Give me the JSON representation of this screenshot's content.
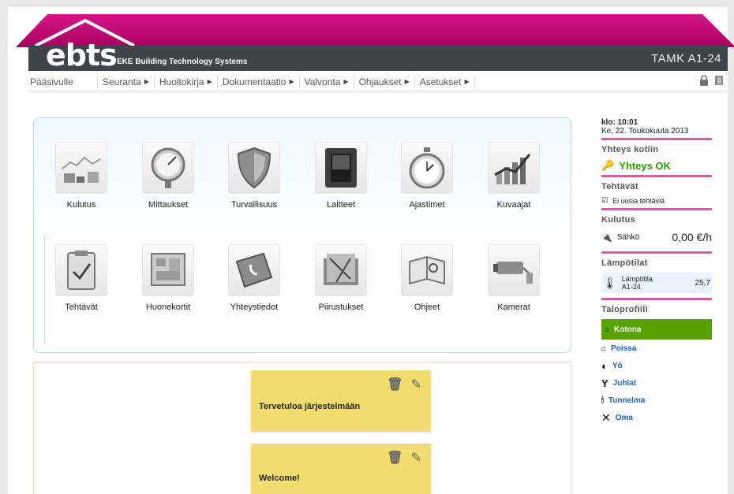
{
  "header": {
    "logo": "ebts",
    "logo_subtitle": "EKE Building Technology Systems",
    "site": "TAMK A1-24",
    "colors": {
      "roof": "#b5006a",
      "bar": "#3f4449"
    }
  },
  "nav": {
    "home": "Pääsivulle",
    "items": [
      "Seuranta",
      "Huoltokirja",
      "Dokumentaatio",
      "Valvonta",
      "Ohjaukset",
      "Asetukset"
    ]
  },
  "tiles": [
    {
      "label": "Kulutus",
      "icon": "consumption-chart-icon"
    },
    {
      "label": "Mittaukset",
      "icon": "gauge-icon"
    },
    {
      "label": "Turvallisuus",
      "icon": "shield-icon"
    },
    {
      "label": "Laitteet",
      "icon": "switch-icon"
    },
    {
      "label": "Ajastimet",
      "icon": "stopwatch-icon"
    },
    {
      "label": "Kuvaajat",
      "icon": "line-chart-icon"
    },
    {
      "label": "Tehtävät",
      "icon": "clipboard-check-icon"
    },
    {
      "label": "Huonekortit",
      "icon": "floorplan-icon"
    },
    {
      "label": "Yhteystiedot",
      "icon": "phone-book-icon"
    },
    {
      "label": "Piirustukset",
      "icon": "drawings-folder-icon"
    },
    {
      "label": "Ohjeet",
      "icon": "instructions-book-icon"
    },
    {
      "label": "Kamerat",
      "icon": "camera-icon"
    }
  ],
  "notes": [
    {
      "title": "Tervetuloa järjestelmään"
    },
    {
      "title": "Welcome!"
    }
  ],
  "sidebar": {
    "time": "klo: 10:01",
    "date": "Ke, 22. Toukokuuta 2013",
    "connection_title": "Yhteys kotiin",
    "connection_status": "Yhteys OK",
    "tasks_title": "Tehtävät",
    "tasks_status": "Ei uusia tehtäviä",
    "consumption_title": "Kulutus",
    "consumption_label": "Sähkö",
    "consumption_value": "0,00 €/h",
    "temps_title": "Lämpötilat",
    "temp_label": "Lämpötila",
    "temp_location": "A1-24",
    "temp_value": "25,7",
    "profile_title": "Taloprofiili",
    "profiles": [
      {
        "label": "Kotona",
        "icon": "home-icon",
        "active": true
      },
      {
        "label": "Poissa",
        "icon": "away-home-icon",
        "active": false
      },
      {
        "label": "Yö",
        "icon": "moon-icon",
        "active": false
      },
      {
        "label": "Juhlat",
        "icon": "cocktail-glass-icon",
        "active": false
      },
      {
        "label": "Tunnelma",
        "icon": "candles-icon",
        "active": false
      },
      {
        "label": "Oma",
        "icon": "tools-icon",
        "active": false
      }
    ],
    "colors": {
      "accent": "#d45ea0",
      "ok": "#2e9e00",
      "active_profile": "#57a300"
    }
  }
}
